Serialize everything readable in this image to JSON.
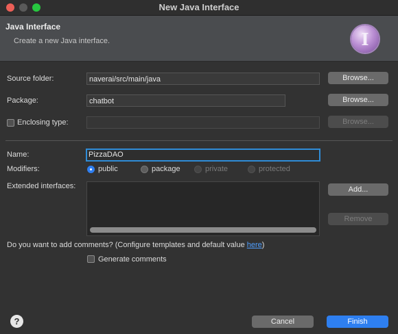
{
  "window": {
    "title": "New Java Interface"
  },
  "header": {
    "title": "Java Interface",
    "subtitle": "Create a new Java interface.",
    "icon": "interface-wizard-icon",
    "icon_letter": "I"
  },
  "form": {
    "source_folder": {
      "label": "Source folder:",
      "value": "naverai/src/main/java",
      "browse_label": "Browse..."
    },
    "package": {
      "label": "Package:",
      "value": "chatbot",
      "browse_label": "Browse..."
    },
    "enclosing_type": {
      "label": "Enclosing type:",
      "value": "",
      "checked": false,
      "browse_label": "Browse..."
    },
    "name": {
      "label": "Name:",
      "value": "PizzaDAO"
    },
    "modifiers": {
      "label": "Modifiers:",
      "options": [
        {
          "label": "public",
          "selected": true,
          "enabled": true
        },
        {
          "label": "package",
          "selected": false,
          "enabled": true
        },
        {
          "label": "private",
          "selected": false,
          "enabled": false
        },
        {
          "label": "protected",
          "selected": false,
          "enabled": false
        }
      ]
    },
    "extended_interfaces": {
      "label": "Extended interfaces:",
      "add_label": "Add...",
      "remove_label": "Remove",
      "items": []
    },
    "comments": {
      "question_prefix": "Do you want to add comments? (Configure templates and default value ",
      "link_text": "here",
      "question_suffix": ")",
      "generate_label": "Generate comments",
      "generate_checked": false
    }
  },
  "footer": {
    "help_glyph": "?",
    "cancel_label": "Cancel",
    "finish_label": "Finish"
  },
  "colors": {
    "accent": "#2e7ff0",
    "background": "#323232",
    "header": "#4a4c4f"
  }
}
